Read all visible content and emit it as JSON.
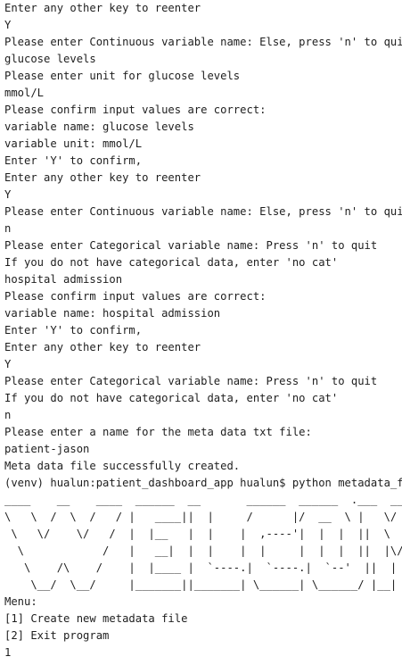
{
  "terminal": {
    "lines_top": [
      "Enter any other key to reenter",
      "Y",
      "Please enter Continuous variable name: Else, press 'n' to quit",
      "glucose levels",
      "Please enter unit for glucose levels",
      "mmol/L",
      "Please confirm input values are correct:",
      "variable name: glucose levels",
      "variable unit: mmol/L",
      "Enter 'Y' to confirm,",
      "Enter any other key to reenter",
      "Y",
      "Please enter Continuous variable name: Else, press 'n' to quit",
      "n",
      "Please enter Categorical variable name: Press 'n' to quit",
      "If you do not have categorical data, enter 'no cat'",
      "hospital admission",
      "Please confirm input values are correct:",
      "variable name: hospital admission",
      "Enter 'Y' to confirm,",
      "Enter any other key to reenter",
      "Y",
      "Please enter Categorical variable name: Press 'n' to quit",
      "If you do not have categorical data, enter 'no cat'",
      "n",
      "Please enter a name for the meta data txt file:",
      "patient-jason",
      "Meta data file successfully created.",
      "(venv) hualun:patient_dashboard_app hualun$ python metadata_file"
    ],
    "banner_lines": [
      "____    __    ____  ______  __       ______  ______  .___  ___.",
      "\\   \\  /  \\  /   / |   ____||  |     /      |/  __  \\ |   \\/   |",
      " \\   \\/    \\/   /  |  |__   |  |    |  ,----'|  |  |  ||  \\  /  |",
      "  \\            /   |   __|  |  |    |  |     |  |  |  ||  |\\/|  |",
      "   \\    /\\    /    |  |____ |  `----.|  `----.|  `--'  ||  |  |  |",
      "    \\__/  \\__/     |_______||_______| \\______| \\______/ |__|  |__|"
    ],
    "menu_title": "Menu:",
    "menu_items": [
      "[1] Create new metadata file",
      "[2] Exit program"
    ],
    "input_value": "1"
  }
}
